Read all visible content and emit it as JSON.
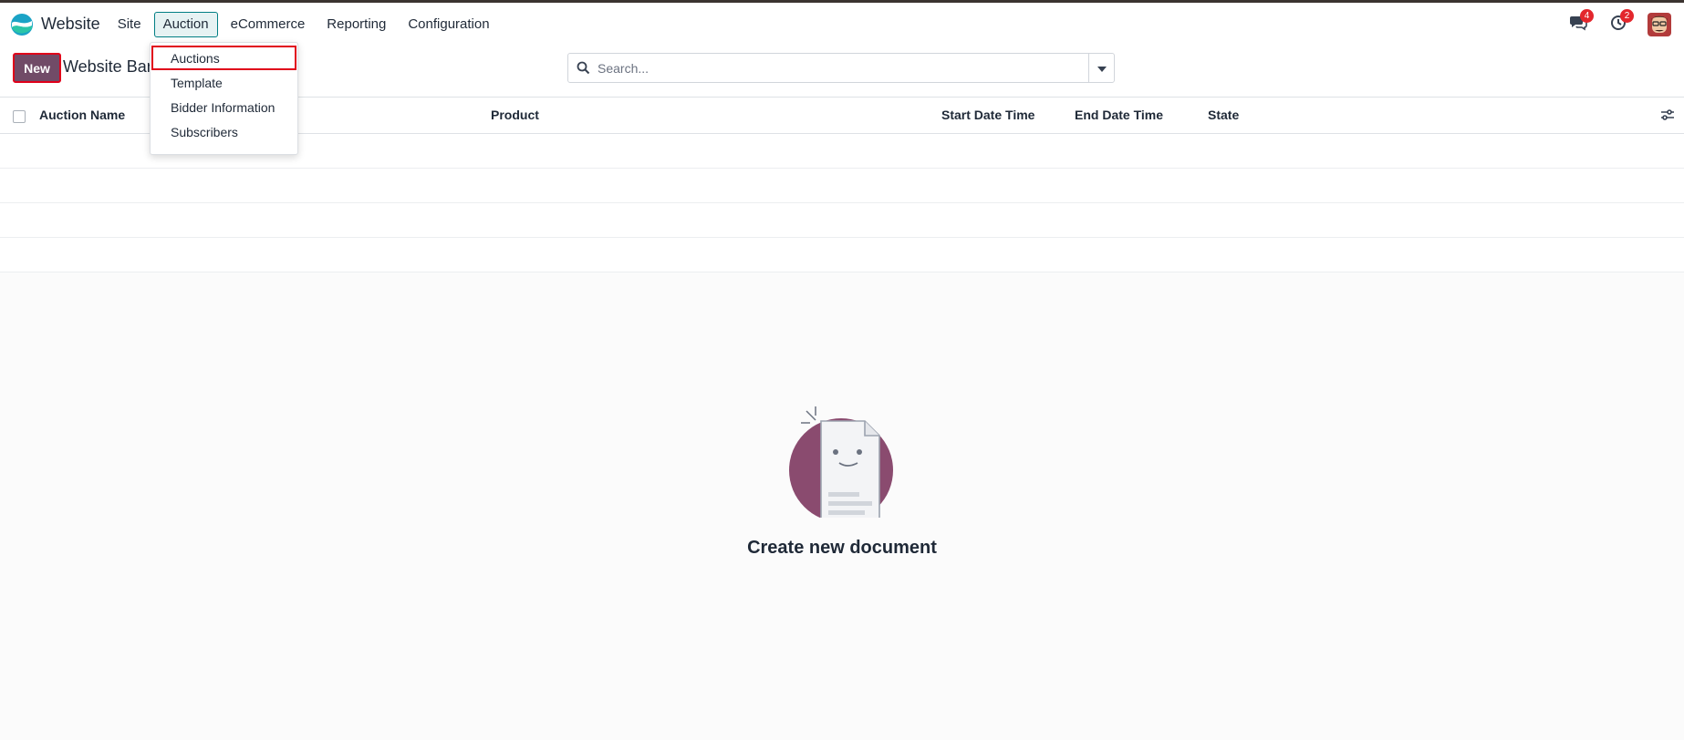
{
  "app": {
    "brand_name": "Website"
  },
  "navbar": {
    "menu": [
      {
        "label": "Site"
      },
      {
        "label": "Auction"
      },
      {
        "label": "eCommerce"
      },
      {
        "label": "Reporting"
      },
      {
        "label": "Configuration"
      }
    ],
    "active_menu": "Auction",
    "messages_badge": "4",
    "activities_badge": "2"
  },
  "dropdown": {
    "items": [
      {
        "label": "Auctions"
      },
      {
        "label": "Template"
      },
      {
        "label": "Bidder Information"
      },
      {
        "label": "Subscribers"
      }
    ]
  },
  "control_panel": {
    "new_button": "New",
    "breadcrumb": "Website Bargain",
    "search_placeholder": "Search..."
  },
  "table": {
    "columns": [
      {
        "label": "Auction Name"
      },
      {
        "label": "Product"
      },
      {
        "label": "Start Date Time"
      },
      {
        "label": "End Date Time"
      },
      {
        "label": "State"
      }
    ],
    "rows": []
  },
  "empty_state": {
    "title": "Create new document"
  },
  "colors": {
    "primary": "#714b67",
    "accent": "#017e84",
    "badge": "#e3272d",
    "highlight": "#e0001a"
  },
  "icons": [
    "website-logo-icon",
    "chat-icon",
    "activity-clock-icon",
    "search-icon",
    "caret-down-icon",
    "optional-columns-icon"
  ]
}
